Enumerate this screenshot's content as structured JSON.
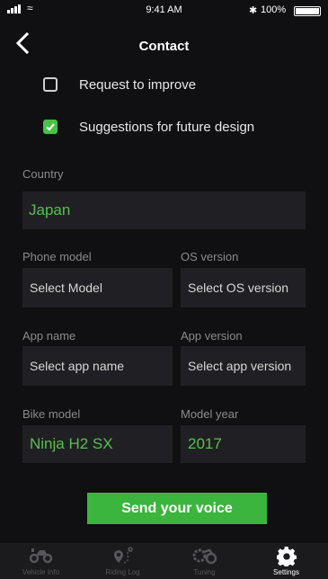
{
  "status_bar": {
    "time": "9:41 AM",
    "battery": "100%"
  },
  "header": {
    "title": "Contact"
  },
  "checkboxes": [
    {
      "label": "Request to improve",
      "checked": false
    },
    {
      "label": "Suggestions for future design",
      "checked": true
    }
  ],
  "form": {
    "country": {
      "label": "Country",
      "value": "Japan"
    },
    "phone_model": {
      "label": "Phone model",
      "placeholder": "Select Model"
    },
    "os_version": {
      "label": "OS version",
      "placeholder": "Select OS version"
    },
    "app_name": {
      "label": "App name",
      "placeholder": "Select app name"
    },
    "app_version": {
      "label": "App version",
      "placeholder": "Select app version"
    },
    "bike_model": {
      "label": "Bike model",
      "value": "Ninja H2 SX"
    },
    "model_year": {
      "label": "Model year",
      "value": "2017"
    }
  },
  "send_button": {
    "label": "Send your voice"
  },
  "tab_bar": {
    "active": "Settings",
    "tabs": [
      {
        "label": "Vehicle Info",
        "icon": "motorcycle-info-icon"
      },
      {
        "label": "Riding Log",
        "icon": "route-pin-icon"
      },
      {
        "label": "Tuning",
        "icon": "tuning-gear-icon"
      },
      {
        "label": "Settings",
        "icon": "gear-icon"
      }
    ]
  },
  "colors": {
    "accent": "#3bb53d",
    "value_text": "#57c04c",
    "background": "#101012",
    "field_bg": "#202024",
    "muted_text": "#8a8a8e"
  }
}
